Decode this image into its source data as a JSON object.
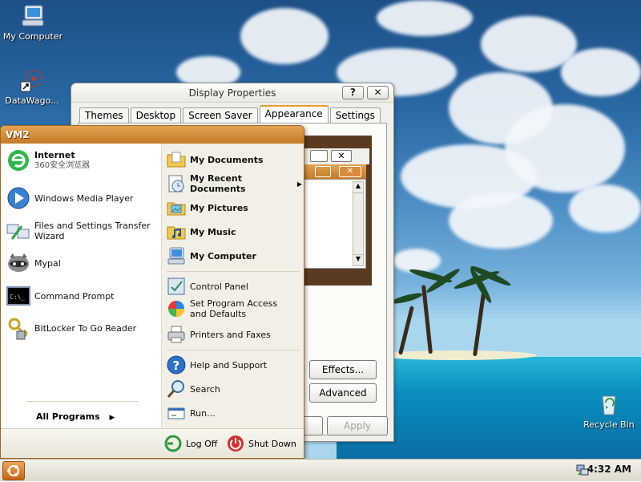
{
  "desktop": {
    "icons": [
      {
        "label": "My Computer"
      },
      {
        "label": "DataWago..."
      },
      {
        "label": "Recycle Bin"
      }
    ]
  },
  "display_properties": {
    "title": "Display Properties",
    "help_label": "?",
    "close_label": "✕",
    "tabs": [
      {
        "label": "Themes"
      },
      {
        "label": "Desktop"
      },
      {
        "label": "Screen Saver"
      },
      {
        "label": "Appearance",
        "active": true
      },
      {
        "label": "Settings"
      }
    ],
    "effects_label": "Effects...",
    "advanced_label": "Advanced",
    "apply_label": "Apply"
  },
  "start_menu": {
    "user_name": "VM2",
    "pinned": {
      "title": "Internet",
      "subtitle": "360安全浏览器"
    },
    "left_items": [
      {
        "label": "Windows Media Player"
      },
      {
        "label": "Files and Settings Transfer Wizard"
      },
      {
        "label": "Mypal"
      },
      {
        "label": "Command Prompt"
      },
      {
        "label": "BitLocker To Go Reader"
      }
    ],
    "all_programs_label": "All Programs",
    "right_items": [
      {
        "label": "My Documents"
      },
      {
        "label": "My Recent Documents",
        "has_submenu": true
      },
      {
        "label": "My Pictures"
      },
      {
        "label": "My Music"
      },
      {
        "label": "My Computer"
      },
      {
        "label": "Control Panel"
      },
      {
        "label": "Set Program Access and Defaults"
      },
      {
        "label": "Printers and Faxes"
      },
      {
        "label": "Help and Support"
      },
      {
        "label": "Search"
      },
      {
        "label": "Run..."
      }
    ],
    "log_off_label": "Log Off",
    "shut_down_label": "Shut Down"
  },
  "taskbar": {
    "clock": "4:32 AM"
  },
  "colors": {
    "start_header": "#c57a26",
    "accent_orange": "#e89c2d",
    "sea": "#0a8fbf"
  }
}
